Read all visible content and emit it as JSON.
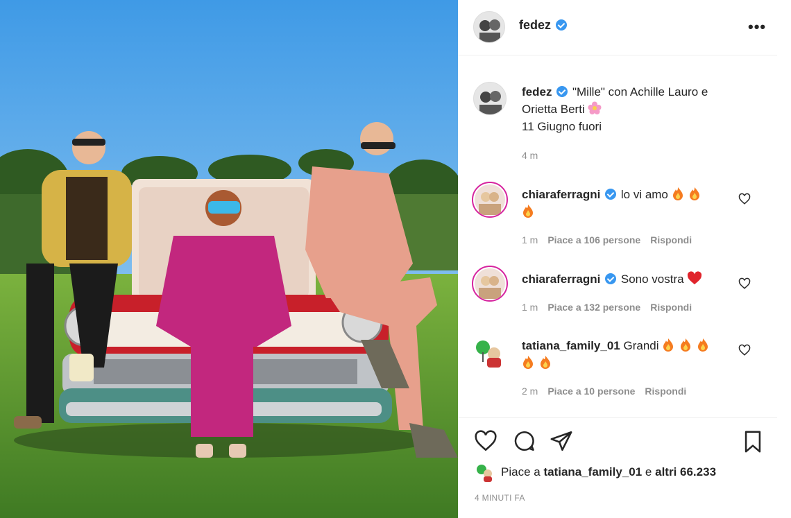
{
  "post": {
    "username": "fedez",
    "more_icon": "more-horizontal-icon"
  },
  "caption": {
    "username": "fedez",
    "line1": "\"Mille\" con Achille Lauro e",
    "line2": "Orietta Berti",
    "line3": "11 Giugno fuori",
    "time": "4 m"
  },
  "comments": [
    {
      "username": "chiaraferragni",
      "text": "lo vi amo",
      "time": "1 m",
      "likes": "Piace a 106 persone",
      "reply": "Rispondi"
    },
    {
      "username": "chiaraferragni",
      "text": "Sono vostra",
      "time": "1 m",
      "likes": "Piace a 132 persone",
      "reply": "Rispondi"
    },
    {
      "username": "tatiana_family_01",
      "text": "Grandi",
      "time": "2 m",
      "likes": "Piace a 10 persone",
      "reply": "Rispondi"
    }
  ],
  "likes": {
    "prefix": "Piace a",
    "user": "tatiana_family_01",
    "middle": "e",
    "others": "altri 66.233"
  },
  "timestamp": "4 MINUTI FA",
  "colors": {
    "verified": "#3897f0",
    "meta": "#8e8e8e",
    "text": "#262626"
  }
}
